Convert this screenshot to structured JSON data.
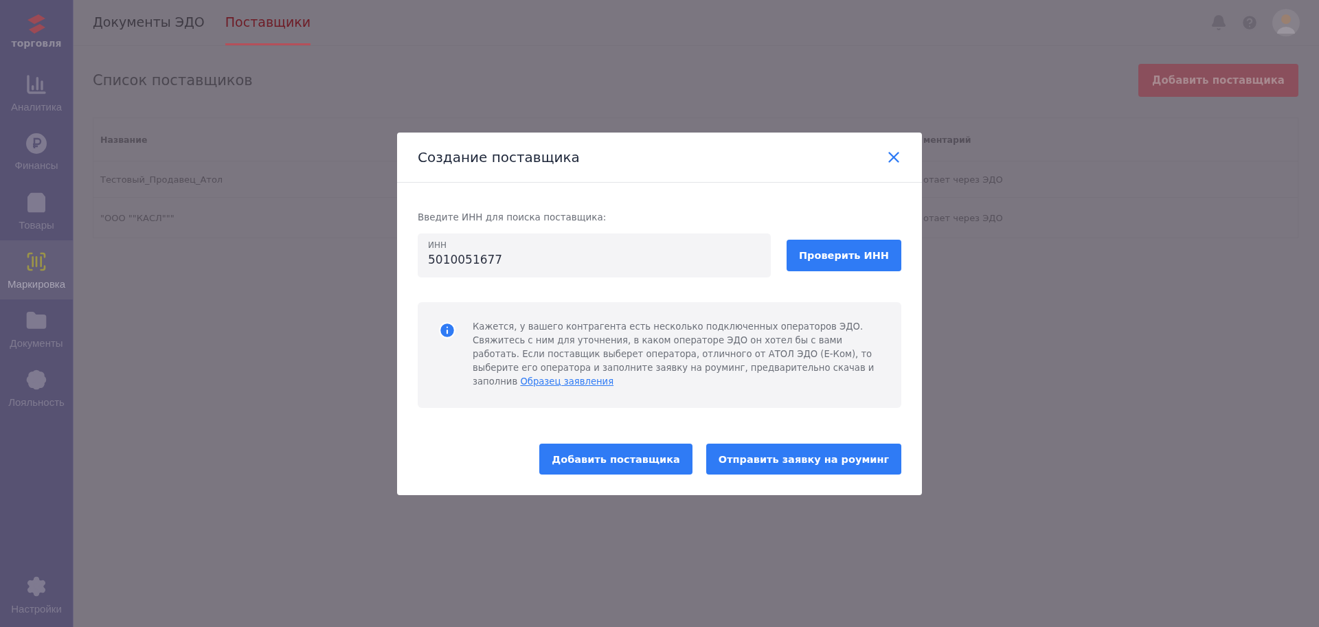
{
  "sidebar": {
    "logo_text": "торговля",
    "items": [
      {
        "kind": "analytics",
        "label": "Аналитика",
        "selected": false
      },
      {
        "kind": "finance",
        "label": "Финансы",
        "selected": false
      },
      {
        "kind": "goods",
        "label": "Товары",
        "selected": false
      },
      {
        "kind": "marking",
        "label": "Маркировка",
        "selected": true
      },
      {
        "kind": "documents",
        "label": "Документы",
        "selected": false
      },
      {
        "kind": "loyalty",
        "label": "Лояльность",
        "selected": false
      }
    ],
    "bottom_item": {
      "kind": "settings",
      "label": "Настройки",
      "selected": false
    }
  },
  "tabs": [
    {
      "label": "Документы ЭДО",
      "selected": false
    },
    {
      "label": "Поставщики",
      "selected": true
    }
  ],
  "page_title": "Список поставщиков",
  "add_button": "Добавить поставщика",
  "table": {
    "columns": [
      "Название",
      "ментарий"
    ],
    "rows": [
      [
        "Тестовый_Продавец_Атол",
        "отает через ЭДО"
      ],
      [
        "\"ООО \"\"КАСЛ\"\"\"",
        "отает через ЭДО"
      ]
    ]
  },
  "modal": {
    "title": "Создание поставщика",
    "prompt": "Введите ИНН для поиска поставщика:",
    "field": {
      "label": "ИНН",
      "value": "5010051677"
    },
    "check_button": "Проверить ИНН",
    "info": {
      "text": "Кажется, у вашего контрагента есть несколько подключенных операторов ЭДО. Свяжитесь с ним для уточнения, в каком операторе ЭДО он хотел бы с вами работать. Если поставщик выберет оператора, отличного от АТОЛ ЭДО (Е-Ком), то выберите его оператора и заполните заявку на роуминг, предварительно скачав и заполнив",
      "link": "Образец заявления"
    },
    "buttons": [
      "Добавить поставщика",
      "Отправить заявку на роуминг"
    ]
  }
}
